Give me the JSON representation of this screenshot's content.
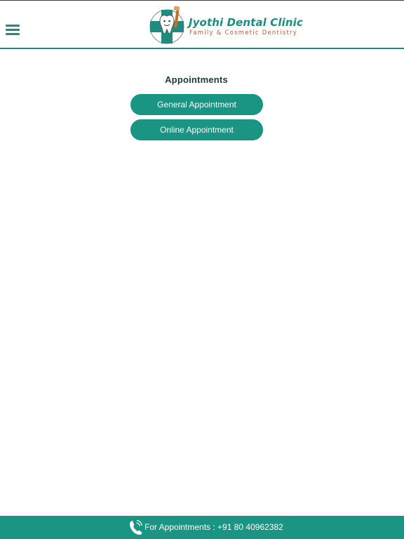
{
  "header": {
    "menu_icon": "hamburger-menu-icon",
    "logo": {
      "icon": "dental-cross-tooth-emblem-icon",
      "title": "Jyothi Dental Clinic",
      "subtitle": "Family & Cosmetic Dentistry"
    }
  },
  "main": {
    "title": "Appointments",
    "buttons": [
      {
        "label": "General Appointment"
      },
      {
        "label": "Online Appointment"
      }
    ]
  },
  "footer": {
    "icon": "phone-icon",
    "text": "For Appointments : +91 80 40962382"
  },
  "colors": {
    "primary": "#1a9483",
    "accent_text": "#1e8c7e",
    "subtitle": "#b0603a",
    "background": "#ffffff"
  }
}
